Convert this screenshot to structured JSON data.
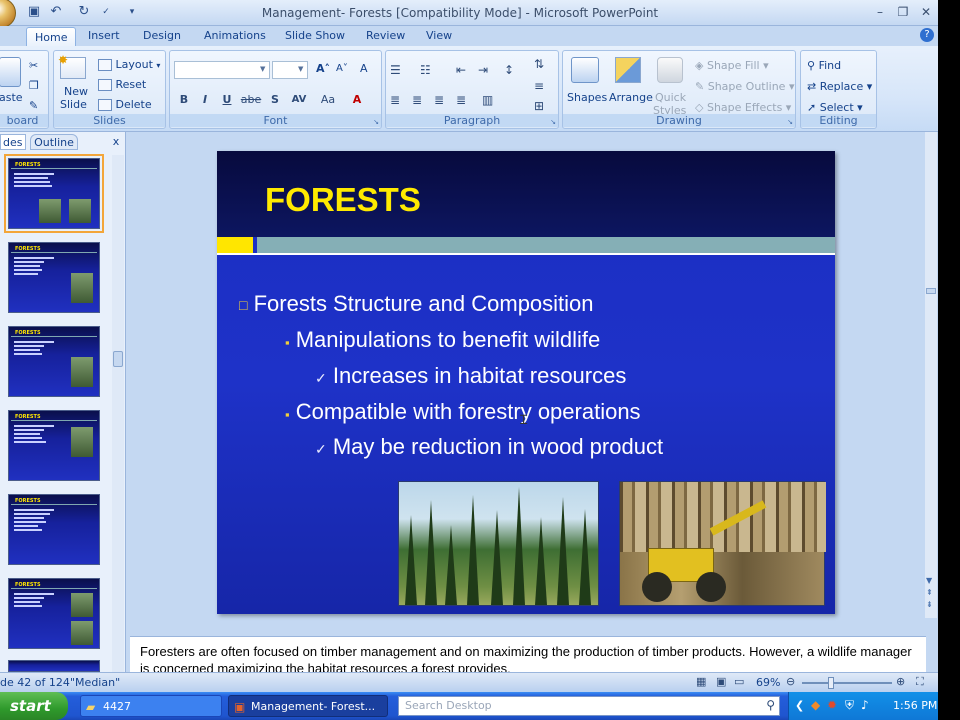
{
  "window": {
    "title": "Management- Forests [Compatibility Mode] - Microsoft PowerPoint",
    "controls": [
      "minimize-icon",
      "restore-icon",
      "close-icon"
    ]
  },
  "quick_access": {
    "save": "save-icon",
    "undo": "undo-icon",
    "redo": "redo-icon",
    "spelling": "spellcheck-icon"
  },
  "ribbon_tabs": [
    "Home",
    "Insert",
    "Design",
    "Animations",
    "Slide Show",
    "Review",
    "View"
  ],
  "active_tab": "Home",
  "ribbon": {
    "clipboard": {
      "paste": "aste",
      "label": "board"
    },
    "slides": {
      "new_slide_1": "New",
      "new_slide_2": "Slide",
      "layout": "Layout",
      "reset": "Reset",
      "delete": "Delete",
      "label": "Slides"
    },
    "font": {
      "font_name": "",
      "font_size": "",
      "bold": "B",
      "italic": "I",
      "underline": "U",
      "strike": "abe",
      "shadow": "S",
      "spacing": "AV",
      "case": "Aa",
      "color": "A",
      "label": "Font"
    },
    "paragraph": {
      "label": "Paragraph"
    },
    "drawing": {
      "shapes": "Shapes",
      "arrange": "Arrange",
      "quick_styles_1": "Quick",
      "quick_styles_2": "Styles",
      "shape_fill": "Shape Fill",
      "shape_outline": "Shape Outline",
      "shape_effects": "Shape Effects",
      "label": "Drawing"
    },
    "editing": {
      "find": "Find",
      "replace": "Replace",
      "select": "Select",
      "label": "Editing"
    }
  },
  "panel": {
    "tab_slides": "des",
    "tab_outline": "Outline",
    "close": "x"
  },
  "thumbnails": [
    {
      "title": "FORESTS"
    },
    {
      "title": "FORESTS"
    },
    {
      "title": "FORESTS"
    },
    {
      "title": "FORESTS"
    },
    {
      "title": "FORESTS"
    },
    {
      "title": "FORESTS"
    }
  ],
  "slide": {
    "title": "FORESTS",
    "bullets": [
      {
        "level": 1,
        "marker": "□",
        "text": "Forests Structure and Composition"
      },
      {
        "level": 2,
        "marker": "▪",
        "text": "Manipulations to benefit wildlife"
      },
      {
        "level": 3,
        "marker": "✓",
        "text": "Increases in habitat resources"
      },
      {
        "level": 2,
        "marker": "▪",
        "text": "Compatible with forestry operations"
      },
      {
        "level": 3,
        "marker": "✓",
        "text": "May be reduction in wood product"
      }
    ]
  },
  "notes": "Foresters are often focused on timber management and on maximizing the production of timber products. However, a wildlife manager is concerned maximizing the habitat resources a forest provides.",
  "status": {
    "slide_count": "de 42 of 124",
    "theme": "\"Median\"",
    "zoom": "69%"
  },
  "taskbar": {
    "start": "start",
    "tasks": [
      {
        "label": "4427",
        "icon": "folder-icon"
      },
      {
        "label": "Management- Forest...",
        "icon": "powerpoint-icon"
      }
    ],
    "search_placeholder": "Search Desktop",
    "clock": "1:56 PM"
  },
  "colors": {
    "slide_bg": "#1e32c8",
    "title_yellow": "#ffea00",
    "accent_teal": "#85afb6",
    "ribbon_blue": "#c4d8f2"
  }
}
